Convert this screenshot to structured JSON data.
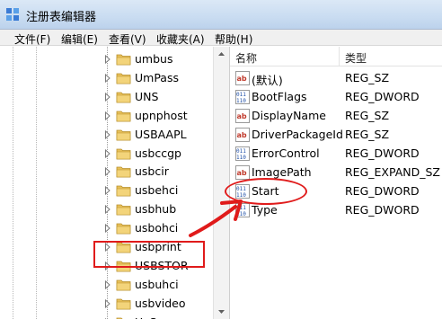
{
  "window": {
    "title": "注册表编辑器"
  },
  "menu": [
    "文件(F)",
    "编辑(E)",
    "查看(V)",
    "收藏夹(A)",
    "帮助(H)"
  ],
  "tree": {
    "items": [
      {
        "label": "umbus"
      },
      {
        "label": "UmPass"
      },
      {
        "label": "UNS"
      },
      {
        "label": "upnphost"
      },
      {
        "label": "USBAAPL"
      },
      {
        "label": "usbccgp"
      },
      {
        "label": "usbcir"
      },
      {
        "label": "usbehci"
      },
      {
        "label": "usbhub"
      },
      {
        "label": "usbohci"
      },
      {
        "label": "usbprint"
      },
      {
        "label": "USBSTOR",
        "highlighted": true
      },
      {
        "label": "usbuhci"
      },
      {
        "label": "usbvideo"
      },
      {
        "label": "UxSms"
      }
    ]
  },
  "list": {
    "headers": {
      "name": "名称",
      "type": "类型"
    },
    "rows": [
      {
        "name": "(默认)",
        "type": "REG_SZ",
        "icon": "string-value-icon"
      },
      {
        "name": "BootFlags",
        "type": "REG_DWORD",
        "icon": "dword-value-icon"
      },
      {
        "name": "DisplayName",
        "type": "REG_SZ",
        "icon": "string-value-icon"
      },
      {
        "name": "DriverPackageId",
        "type": "REG_SZ",
        "icon": "string-value-icon"
      },
      {
        "name": "ErrorControl",
        "type": "REG_DWORD",
        "icon": "dword-value-icon"
      },
      {
        "name": "ImagePath",
        "type": "REG_EXPAND_SZ",
        "icon": "string-value-icon"
      },
      {
        "name": "Start",
        "type": "REG_DWORD",
        "icon": "dword-value-icon",
        "circled": true
      },
      {
        "name": "Type",
        "type": "REG_DWORD",
        "icon": "dword-value-icon"
      }
    ]
  },
  "colors": {
    "annotation": "#e01b1b",
    "folder": "#e8c15a"
  }
}
